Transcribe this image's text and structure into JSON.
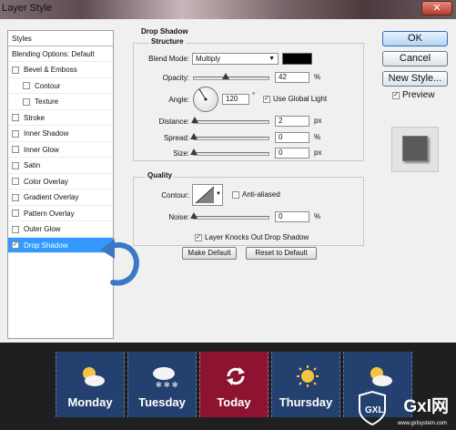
{
  "window": {
    "title": "Layer Style"
  },
  "styles_list": {
    "header": "Styles",
    "items": [
      {
        "label": "Blending Options: Default",
        "checkbox": false,
        "indent": false,
        "checked": false,
        "selected": false
      },
      {
        "label": "Bevel & Emboss",
        "checkbox": true,
        "indent": false,
        "checked": false,
        "selected": false
      },
      {
        "label": "Contour",
        "checkbox": true,
        "indent": true,
        "checked": false,
        "selected": false
      },
      {
        "label": "Texture",
        "checkbox": true,
        "indent": true,
        "checked": false,
        "selected": false
      },
      {
        "label": "Stroke",
        "checkbox": true,
        "indent": false,
        "checked": false,
        "selected": false
      },
      {
        "label": "Inner Shadow",
        "checkbox": true,
        "indent": false,
        "checked": false,
        "selected": false
      },
      {
        "label": "Inner Glow",
        "checkbox": true,
        "indent": false,
        "checked": false,
        "selected": false
      },
      {
        "label": "Satin",
        "checkbox": true,
        "indent": false,
        "checked": false,
        "selected": false
      },
      {
        "label": "Color Overlay",
        "checkbox": true,
        "indent": false,
        "checked": false,
        "selected": false
      },
      {
        "label": "Gradient Overlay",
        "checkbox": true,
        "indent": false,
        "checked": false,
        "selected": false
      },
      {
        "label": "Pattern Overlay",
        "checkbox": true,
        "indent": false,
        "checked": false,
        "selected": false
      },
      {
        "label": "Outer Glow",
        "checkbox": true,
        "indent": false,
        "checked": false,
        "selected": false
      },
      {
        "label": "Drop Shadow",
        "checkbox": true,
        "indent": false,
        "checked": true,
        "selected": true
      }
    ]
  },
  "drop_shadow": {
    "title": "Drop Shadow",
    "structure": {
      "title": "Structure",
      "blend_mode_label": "Blend Mode:",
      "blend_mode_value": "Multiply",
      "shadow_color": "#000000",
      "opacity_label": "Opacity:",
      "opacity_value": "42",
      "opacity_unit": "%",
      "opacity_level": 0.42,
      "angle_label": "Angle:",
      "angle_value": "120",
      "angle_unit": "°",
      "use_global_light_label": "Use Global Light",
      "use_global_light_checked": true,
      "distance_label": "Distance:",
      "distance_value": "2",
      "distance_unit": "px",
      "spread_label": "Spread:",
      "spread_value": "0",
      "spread_unit": "%",
      "size_label": "Size:",
      "size_value": "0",
      "size_unit": "px"
    },
    "quality": {
      "title": "Quality",
      "contour_label": "Contour:",
      "anti_aliased_label": "Anti-aliased",
      "anti_aliased_checked": false,
      "noise_label": "Noise:",
      "noise_value": "0",
      "noise_unit": "%"
    },
    "knockout_label": "Layer Knocks Out Drop Shadow",
    "knockout_checked": true,
    "make_default_label": "Make Default",
    "reset_default_label": "Reset to Default"
  },
  "side_buttons": {
    "ok": "OK",
    "cancel": "Cancel",
    "new_style": "New Style...",
    "preview_label": "Preview",
    "preview_checked": true
  },
  "weather_cards": [
    {
      "label": "Monday",
      "icon": "sun-cloud-icon",
      "active": false
    },
    {
      "label": "Tuesday",
      "icon": "snow-cloud-icon",
      "active": false
    },
    {
      "label": "Today",
      "icon": "refresh-icon",
      "active": true
    },
    {
      "label": "Thursday",
      "icon": "sun-icon",
      "active": false
    },
    {
      "label": "",
      "icon": "sun-cloud-icon",
      "active": false
    }
  ],
  "watermark": {
    "brand": "Gxl",
    "suffix": "网",
    "url": "www.gxlsystem.com"
  },
  "colors": {
    "card_blue": "#24406f",
    "card_active": "#8c1431",
    "selection": "#3399ff",
    "arrow": "#3b78c4"
  }
}
